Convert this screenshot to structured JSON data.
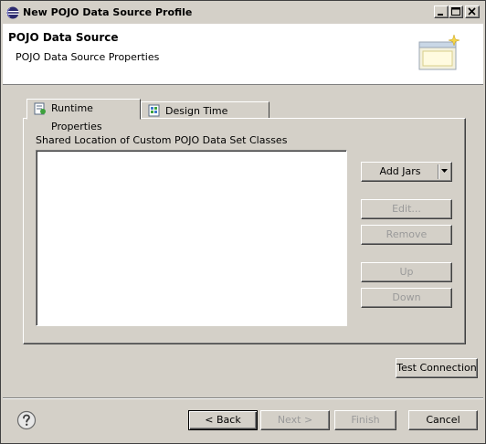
{
  "window": {
    "title": "New POJO Data Source Profile"
  },
  "header": {
    "title": "POJO Data Source",
    "subtitle": "POJO Data Source Properties",
    "icon": "wizard-banner-icon"
  },
  "tabs": [
    {
      "label": "Runtime Properties",
      "selected": true,
      "icon": "runtime-properties-icon"
    },
    {
      "label": "Design Time Properties",
      "selected": false,
      "icon": "design-time-properties-icon"
    }
  ],
  "runtime": {
    "list_label": "Shared Location of Custom POJO Data Set Classes",
    "buttons": {
      "add_jars": "Add Jars",
      "edit": "Edit...",
      "remove": "Remove",
      "up": "Up",
      "down": "Down"
    }
  },
  "test_connection": "Test Connection",
  "footer": {
    "back": "< Back",
    "next": "Next >",
    "finish": "Finish",
    "cancel": "Cancel"
  }
}
